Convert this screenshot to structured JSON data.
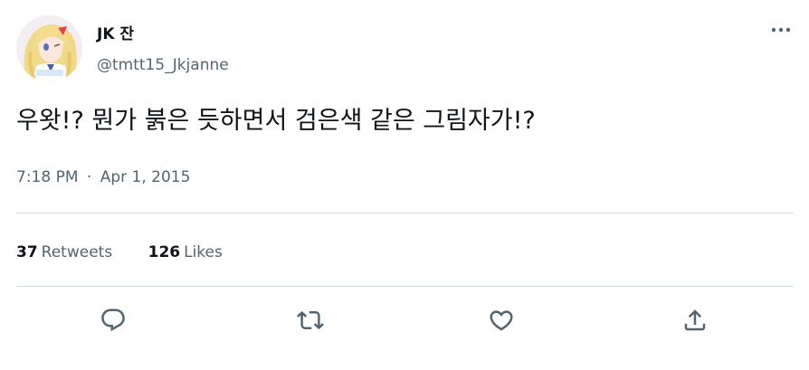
{
  "author": {
    "display_name": "JK 잔",
    "handle": "@tmtt15_Jkjanne",
    "avatar_icon": "anime-character-avatar"
  },
  "tweet": {
    "text": "우왓!? 뭔가 붉은 듯하면서 검은색 같은 그림자가!?",
    "time": "7:18 PM",
    "separator": "·",
    "date": "Apr 1, 2015"
  },
  "stats": {
    "retweets_count": "37",
    "retweets_label": "Retweets",
    "likes_count": "126",
    "likes_label": "Likes"
  },
  "actions": [
    "reply-icon",
    "retweet-icon",
    "like-icon",
    "share-icon"
  ],
  "colors": {
    "text_primary": "#0f1419",
    "text_secondary": "#536471",
    "divider": "#cfd9de"
  }
}
